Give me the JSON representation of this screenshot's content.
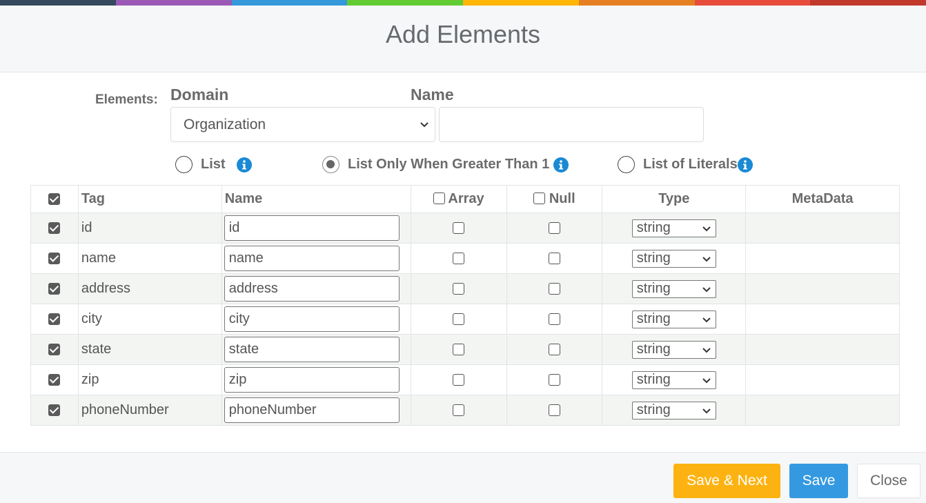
{
  "stripe_colors": [
    "#34495e",
    "#9b59b6",
    "#3498db",
    "#62cb31",
    "#ffb606",
    "#e67e22",
    "#e74c3c",
    "#c0392b"
  ],
  "dialog": {
    "title": "Add Elements"
  },
  "form": {
    "elements_label": "Elements:",
    "domain_label": "Domain",
    "name_label": "Name",
    "domain_value": "Organization",
    "name_value": ""
  },
  "list_options": [
    {
      "label": "List",
      "checked": false,
      "has_info": true
    },
    {
      "label": "List Only When Greater Than 1",
      "checked": true,
      "has_info": true
    },
    {
      "label": "List of Literals",
      "checked": false,
      "has_info": true
    }
  ],
  "table": {
    "headers": {
      "select_all_checked": true,
      "tag": "Tag",
      "name": "Name",
      "array": "Array",
      "array_checked": false,
      "null": "Null",
      "null_checked": false,
      "type": "Type",
      "metadata": "MetaData"
    },
    "rows": [
      {
        "selected": true,
        "tag": "id",
        "name": "id",
        "array": false,
        "null": false,
        "type": "string",
        "metadata": ""
      },
      {
        "selected": true,
        "tag": "name",
        "name": "name",
        "array": false,
        "null": false,
        "type": "string",
        "metadata": ""
      },
      {
        "selected": true,
        "tag": "address",
        "name": "address",
        "array": false,
        "null": false,
        "type": "string",
        "metadata": ""
      },
      {
        "selected": true,
        "tag": "city",
        "name": "city",
        "array": false,
        "null": false,
        "type": "string",
        "metadata": ""
      },
      {
        "selected": true,
        "tag": "state",
        "name": "state",
        "array": false,
        "null": false,
        "type": "string",
        "metadata": ""
      },
      {
        "selected": true,
        "tag": "zip",
        "name": "zip",
        "array": false,
        "null": false,
        "type": "string",
        "metadata": ""
      },
      {
        "selected": true,
        "tag": "phoneNumber",
        "name": "phoneNumber",
        "array": false,
        "null": false,
        "type": "string",
        "metadata": ""
      }
    ]
  },
  "footer": {
    "save_next_label": "Save & Next",
    "save_label": "Save",
    "close_label": "Close"
  },
  "colors": {
    "save_next": "#fcb312",
    "save": "#3499e0",
    "info_icon": "#1a8ad4"
  },
  "icons": {
    "info": "info-circle-icon",
    "chevron": "chevron-down-icon",
    "checkbox": "checkbox-icon"
  }
}
